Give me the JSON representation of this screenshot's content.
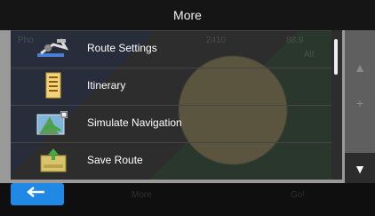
{
  "window": {
    "title": "More"
  },
  "menu": {
    "items": [
      {
        "label": "Route Settings",
        "icon": "route-settings-icon"
      },
      {
        "label": "Itinerary",
        "icon": "itinerary-icon"
      },
      {
        "label": "Simulate Navigation",
        "icon": "simulate-navigation-icon"
      },
      {
        "label": "Save Route",
        "icon": "save-route-icon"
      }
    ]
  },
  "side_panel": {
    "up_icon": "up-arrow-icon",
    "plus_icon": "plus-icon",
    "down_icon": "down-arrow-icon"
  },
  "bottom": {
    "back_icon": "back-arrow-icon",
    "back_color": "#1f89e5"
  }
}
